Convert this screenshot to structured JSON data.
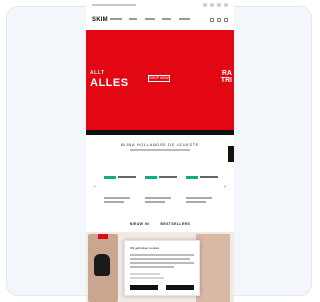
{
  "site": {
    "logo": "SKIM"
  },
  "hero": {
    "kicker": "ALLT",
    "headline": "ALLES",
    "cta": "SHOP NOW",
    "right_line1": "RA",
    "right_line2": "TRI"
  },
  "section": {
    "title": "BIJNA HOLLANDSE DE LEUKSTE"
  },
  "tabs": [
    "NIEUW IN",
    "BESTSELLERS"
  ],
  "modal": {
    "title": "Wij gebruiken cookies"
  },
  "colors": {
    "brand_red": "#e30613",
    "accent_green": "#0fae84"
  }
}
